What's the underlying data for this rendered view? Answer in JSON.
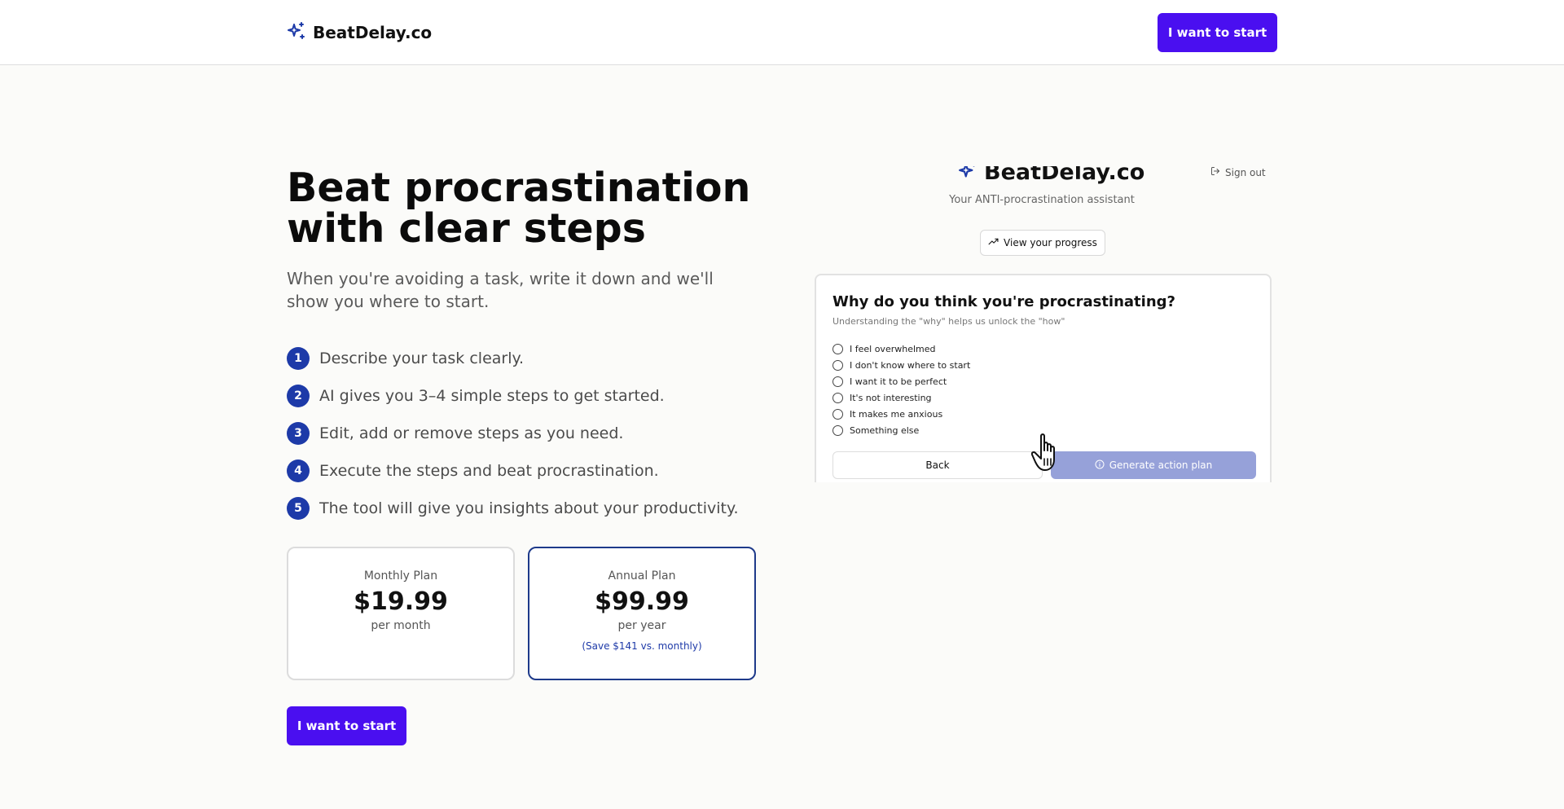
{
  "header": {
    "logo_text": "BeatDelay.co",
    "cta_label": "I want to start"
  },
  "hero": {
    "title_line1": "Beat procrastination",
    "title_line2": "with clear steps",
    "subtitle": "When you're avoiding a task, write it down and we'll show you where to start."
  },
  "steps": [
    {
      "num": "1",
      "text": "Describe your task clearly."
    },
    {
      "num": "2",
      "text": "AI gives you 3–4 simple steps to get started."
    },
    {
      "num": "3",
      "text": "Edit, add or remove steps as you need."
    },
    {
      "num": "4",
      "text": "Execute the steps and beat procrastination."
    },
    {
      "num": "5",
      "text": "The tool will give you insights about your productivity."
    }
  ],
  "plans": {
    "monthly": {
      "name": "Monthly Plan",
      "price": "$19.99",
      "period": "per month"
    },
    "annual": {
      "name": "Annual Plan",
      "price": "$99.99",
      "period": "per year",
      "save": "(Save $141 vs. monthly)"
    }
  },
  "bottom_cta_label": "I want to start",
  "preview": {
    "logo_text": "BeatDelay.co",
    "signout_label": "Sign out",
    "tagline": "Your ANTI-procrastination assistant",
    "progress_label": "View your progress",
    "question_title": "Why do you think you're procrastinating?",
    "question_subtitle": "Understanding the \"why\" helps us unlock the \"how\"",
    "options": [
      "I feel overwhelmed",
      "I don't know where to start",
      "I want it to be perfect",
      "It's not interesting",
      "It makes me anxious",
      "Something else"
    ],
    "back_label": "Back",
    "generate_label": "Generate action plan"
  },
  "colors": {
    "brand_purple": "#4a0ff0",
    "step_blue": "#1d3aa8",
    "annual_border": "#1e3a8a",
    "generate_disabled": "#96a1d9"
  },
  "icons": {
    "logo": "sparkle-icon",
    "signout": "sign-out-icon",
    "progress": "trending-up-icon",
    "generate": "info-icon",
    "cursor": "hand-pointer-icon"
  }
}
